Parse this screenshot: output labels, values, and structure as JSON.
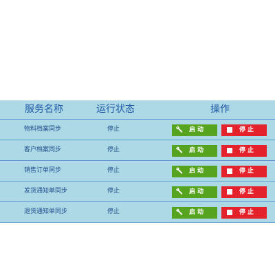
{
  "table": {
    "headers": {
      "name": "服务名称",
      "status": "运行状态",
      "actions": "操作"
    },
    "rows": [
      {
        "name": "物料档案同步",
        "status": "停止",
        "start_label": "启动",
        "stop_label": "停止"
      },
      {
        "name": "客户档案同步",
        "status": "停止",
        "start_label": "启动",
        "stop_label": "停止"
      },
      {
        "name": "销售订单同步",
        "status": "停止",
        "start_label": "启动",
        "stop_label": "停止"
      },
      {
        "name": "发货通知单同步",
        "status": "停止",
        "start_label": "启动",
        "stop_label": "停止"
      },
      {
        "name": "退货通知单同步",
        "status": "停止",
        "start_label": "启动",
        "stop_label": "停止"
      }
    ]
  },
  "colors": {
    "table_background": "#add8e6",
    "row_divider": "#5c9ccf",
    "header_text": "#1f5aa6",
    "start_button": "#56a31f",
    "stop_button": "#e3222b"
  },
  "icons": {
    "start": "wrench-icon",
    "stop": "stop-square-icon"
  }
}
